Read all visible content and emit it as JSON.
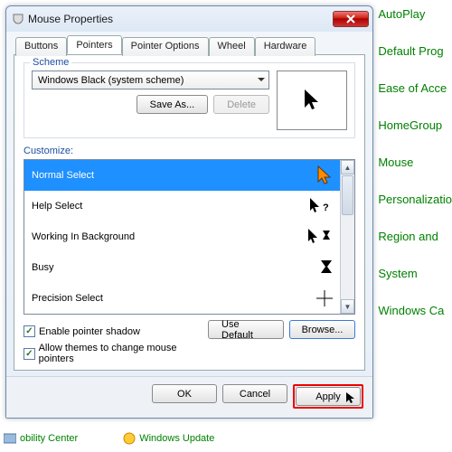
{
  "bg": {
    "right": [
      "AutoPlay",
      "Default Prog",
      "Ease of Acce",
      "HomeGroup",
      "Mouse",
      "Personalizatio",
      "Region and",
      "System",
      "Windows Ca"
    ],
    "bottom": [
      "obility Center",
      "Windows Update"
    ]
  },
  "dialog": {
    "title": "Mouse Properties",
    "tabs": [
      "Buttons",
      "Pointers",
      "Pointer Options",
      "Wheel",
      "Hardware"
    ],
    "activeTab": 1,
    "scheme": {
      "legend": "Scheme",
      "value": "Windows Black (system scheme)",
      "saveAs": "Save As...",
      "delete": "Delete"
    },
    "customizeLabel": "Customize:",
    "items": [
      {
        "label": "Normal Select",
        "icon": "arrow-orange"
      },
      {
        "label": "Help Select",
        "icon": "help"
      },
      {
        "label": "Working In Background",
        "icon": "arrow-hourglass"
      },
      {
        "label": "Busy",
        "icon": "hourglass"
      },
      {
        "label": "Precision Select",
        "icon": "cross"
      }
    ],
    "selectedIndex": 0,
    "chk1": "Enable pointer shadow",
    "chk2": "Allow themes to change mouse pointers",
    "useDefault": "Use Default",
    "browse": "Browse...",
    "ok": "OK",
    "cancel": "Cancel",
    "apply": "Apply"
  }
}
